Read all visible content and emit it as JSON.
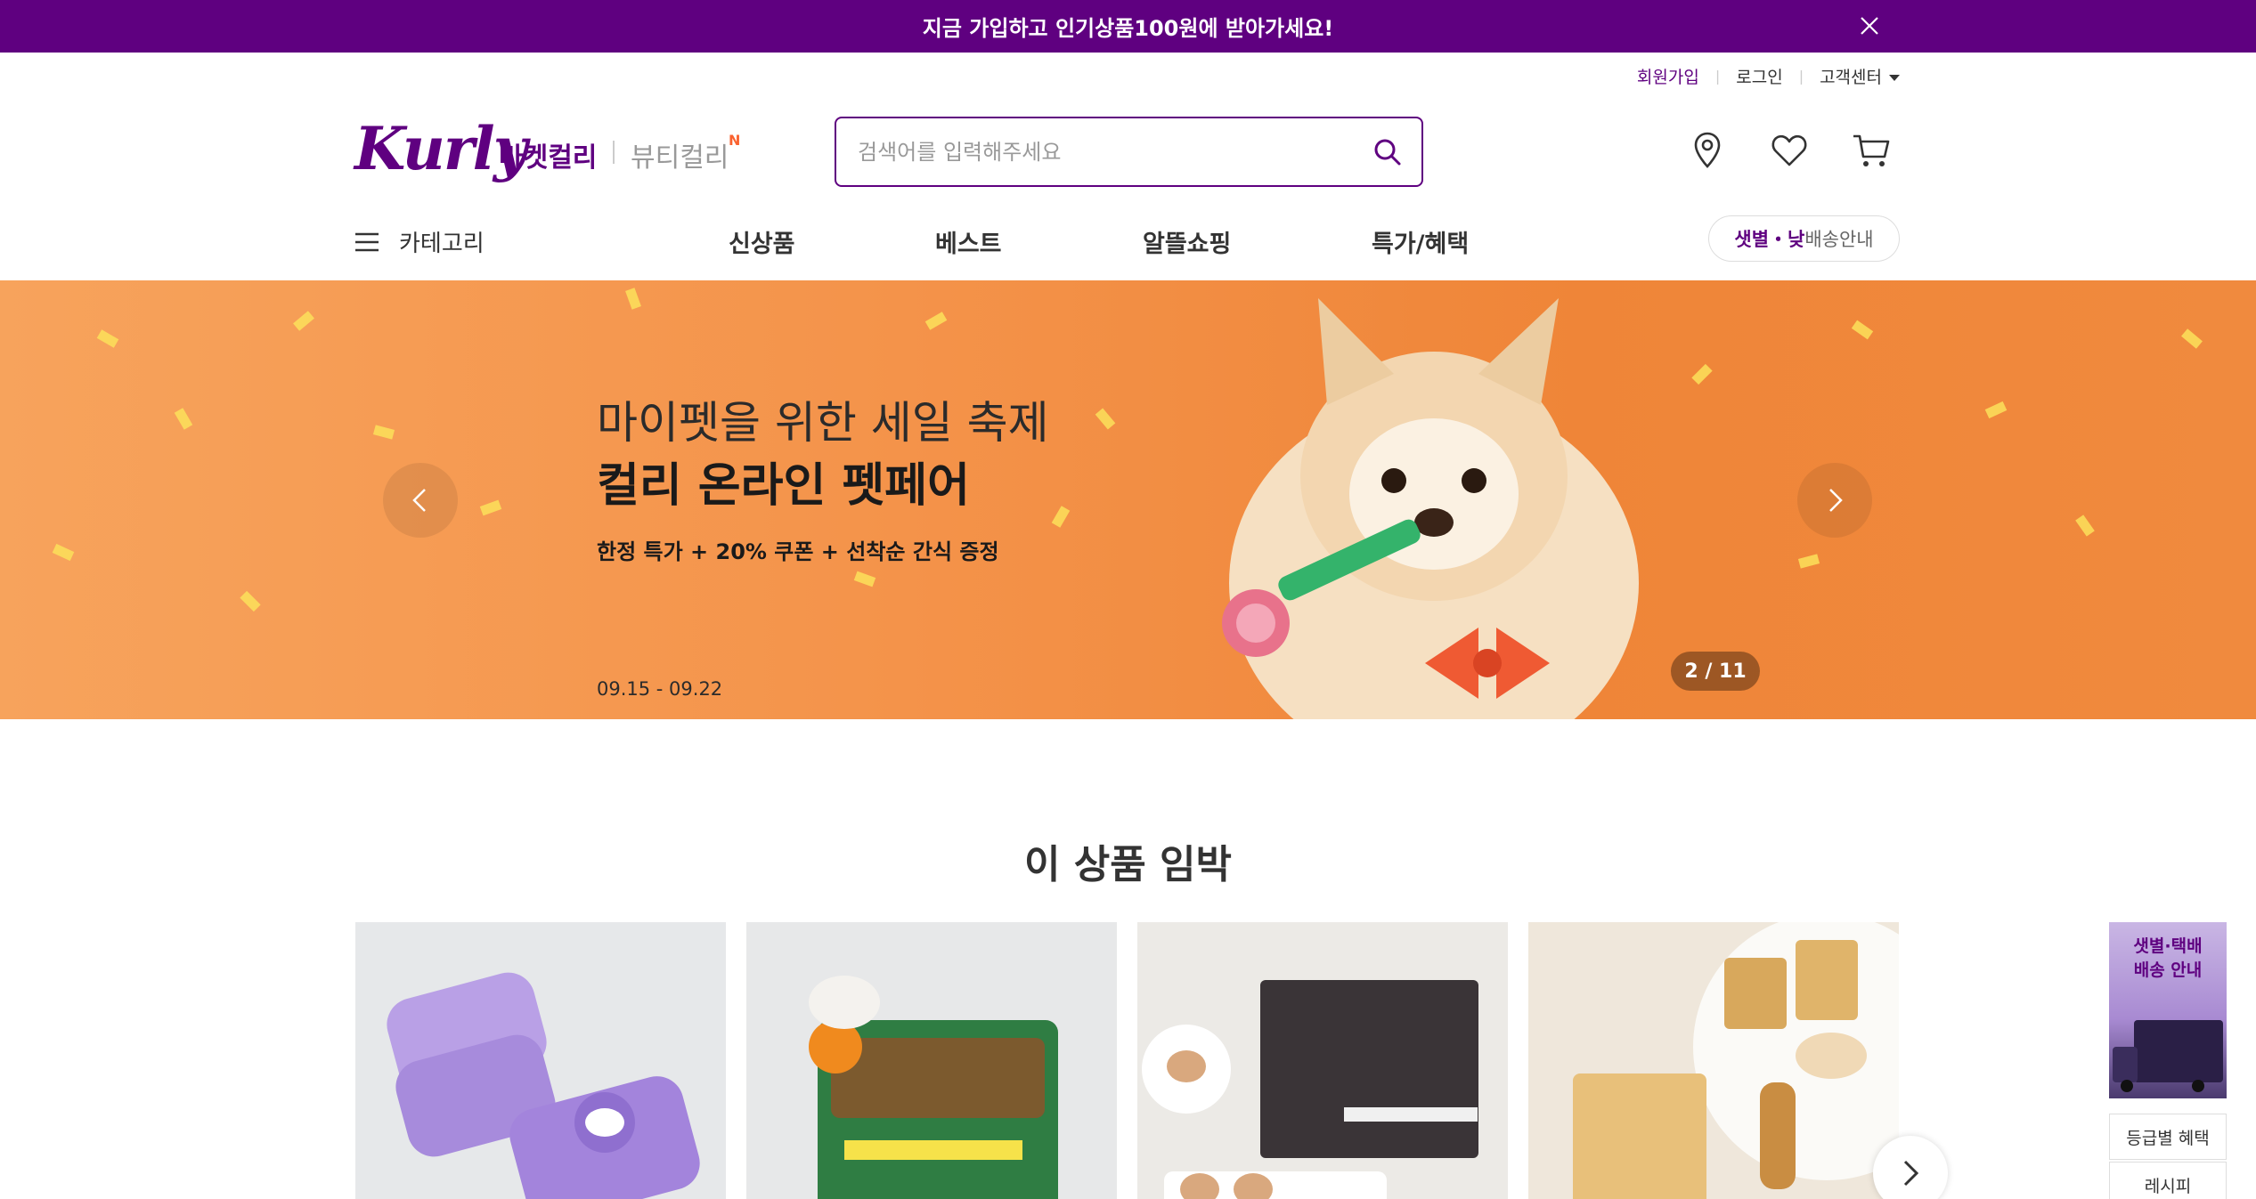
{
  "promo": {
    "text": "지금 가입하고 인기상품100원에 받아가세요!"
  },
  "util": {
    "signup": "회원가입",
    "login": "로그인",
    "customer_center": "고객센터"
  },
  "header": {
    "logo": "Kurly",
    "market_tab": "마켓컬리",
    "beauty_tab": "뷰티컬리",
    "beauty_badge": "N",
    "search_placeholder": "검색어를 입력해주세요"
  },
  "gnb": {
    "category": "카테고리",
    "items": [
      "신상품",
      "베스트",
      "알뜰쇼핑",
      "특가/혜택"
    ],
    "delivery_strong": "샛별・낮",
    "delivery_rest": "배송안내"
  },
  "banner": {
    "subtitle": "마이펫을 위한 세일 축제",
    "title": "컬리 온라인 펫페어",
    "desc": "한정 특가 + 20% 쿠폰 + 선착순 간식 증정",
    "date": "09.15 - 09.22",
    "counter": "2 / 11"
  },
  "section": {
    "title": "이 상품 임박"
  },
  "side": {
    "banner_line1": "샛별·택배",
    "banner_line2": "배송 안내",
    "links": [
      "등급별 혜택",
      "레시피"
    ]
  },
  "colors": {
    "brand": "#5f0080",
    "banner_bg": "#f4934a",
    "badge_n": "#fa622f"
  }
}
